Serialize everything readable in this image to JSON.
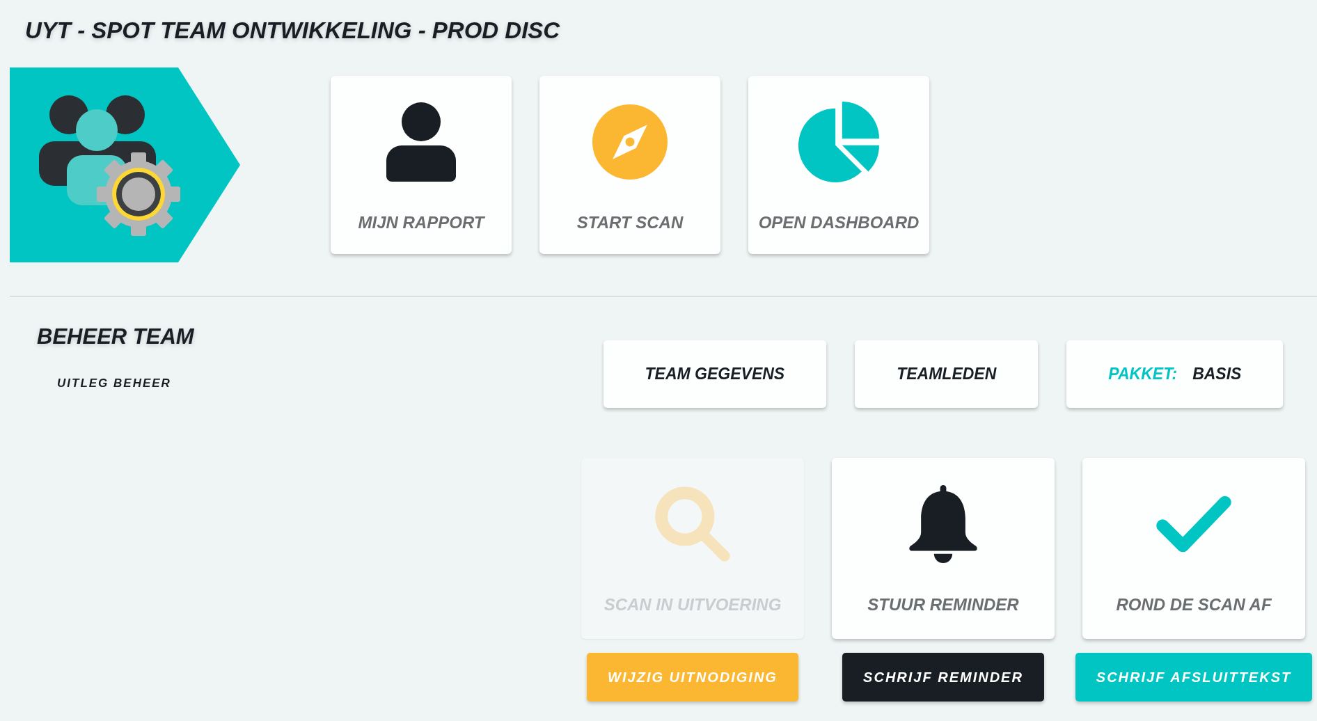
{
  "header": {
    "title": "UYT - SPOT TEAM ONTWIKKELING - PROD DISC"
  },
  "quick_actions": [
    {
      "label": "MIJN RAPPORT",
      "disabled": false
    },
    {
      "label": "START SCAN",
      "disabled": false
    },
    {
      "label": "OPEN DASHBOARD",
      "disabled": false
    }
  ],
  "manage": {
    "title": "BEHEER TEAM",
    "help_link": "UITLEG BEHEER",
    "settings_buttons": [
      {
        "label": "TEAM GEGEVENS"
      },
      {
        "label": "TEAMLEDEN"
      }
    ],
    "package": {
      "label": "PAKKET:",
      "value": "BASIS"
    },
    "scan_actions": [
      {
        "label": "SCAN IN UITVOERING",
        "disabled": true,
        "button": {
          "label": "WIJZIG UITNODIGING",
          "color": "#fbb731"
        }
      },
      {
        "label": "STUUR REMINDER",
        "disabled": false,
        "button": {
          "label": "SCHRIJF REMINDER",
          "color": "#181e24"
        }
      },
      {
        "label": "ROND DE SCAN AF",
        "disabled": false,
        "button": {
          "label": "SCHRIJF AFSLUITTEKST",
          "color": "#00c5c2"
        }
      }
    ]
  }
}
